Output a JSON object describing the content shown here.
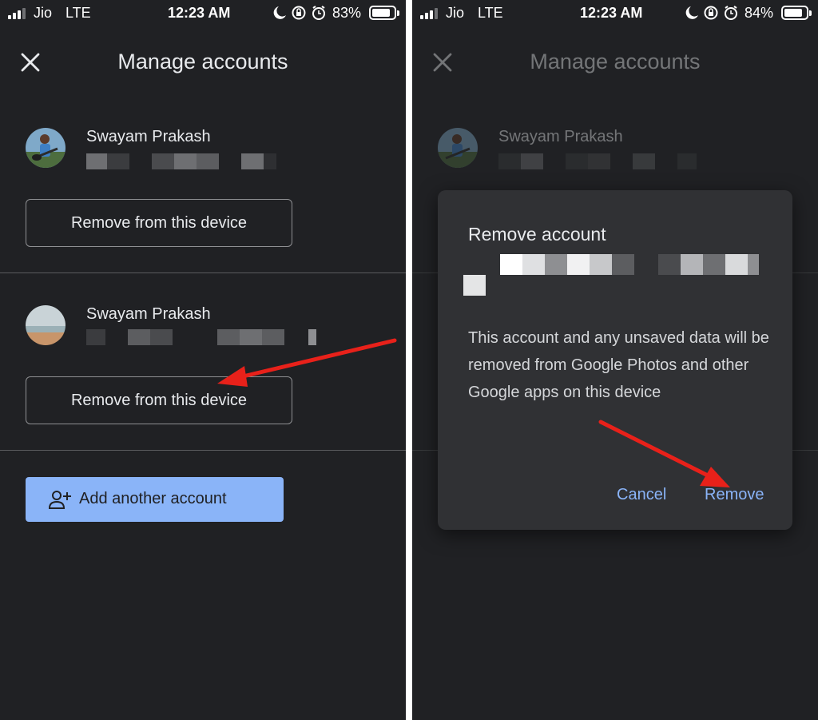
{
  "left_screen": {
    "status": {
      "carrier": "Jio",
      "network": "LTE",
      "time": "12:23 AM",
      "battery_percent": "83%",
      "battery_level": 0.83
    },
    "header": {
      "title": "Manage accounts",
      "close_icon": "close-icon"
    },
    "accounts": [
      {
        "name": "Swayam Prakash",
        "avatar_icon": "guitar-photo-avatar",
        "remove_label": "Remove from this device"
      },
      {
        "name": "Swayam Prakash",
        "avatar_icon": "beach-photo-avatar",
        "remove_label": "Remove from this device"
      }
    ],
    "add_account_label": "Add another account",
    "add_account_icon": "person-add-icon"
  },
  "right_screen": {
    "status": {
      "carrier": "Jio",
      "network": "LTE",
      "time": "12:23 AM",
      "battery_percent": "84%",
      "battery_level": 0.84
    },
    "header": {
      "title": "Manage accounts"
    },
    "account": {
      "name": "Swayam Prakash"
    },
    "dialog": {
      "title": "Remove account",
      "body": "This account and any unsaved data will be removed from Google Photos and other Google apps on this device",
      "cancel_label": "Cancel",
      "remove_label": "Remove"
    }
  },
  "colors": {
    "background": "#202124",
    "dialog_background": "#303134",
    "accent_blue": "#8ab4f8",
    "annotation_red": "#e8211a"
  }
}
